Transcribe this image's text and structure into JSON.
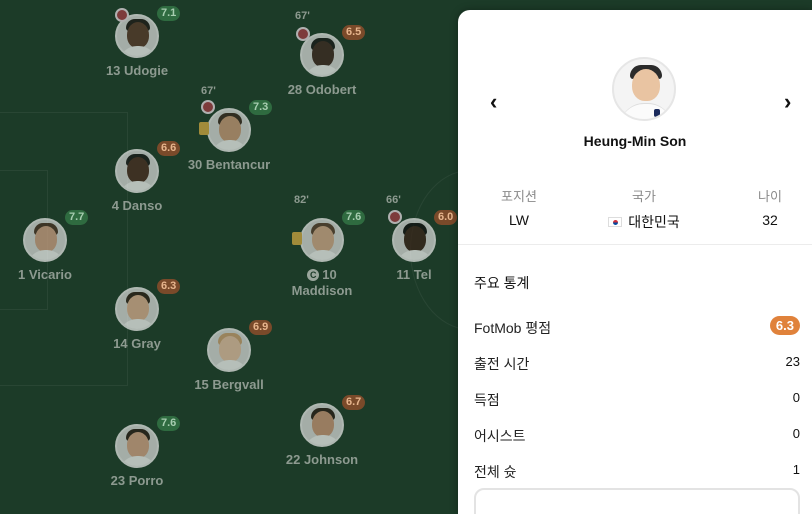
{
  "players": [
    {
      "id": "udogie",
      "name": "13 Udogie",
      "rating": "7.1",
      "color": "green",
      "sub": true,
      "min": ""
    },
    {
      "id": "odobert",
      "name": "28 Odobert",
      "rating": "6.5",
      "color": "orange",
      "sub": true,
      "min": "67'"
    },
    {
      "id": "bentancur",
      "name": "30 Bentancur",
      "rating": "7.3",
      "color": "green",
      "sub": true,
      "min": "67'",
      "card": true
    },
    {
      "id": "danso",
      "name": "4 Danso",
      "rating": "6.6",
      "color": "orange"
    },
    {
      "id": "maddison",
      "name_line1": "10",
      "name_line2": "Maddison",
      "rating": "7.6",
      "color": "green",
      "min": "82'",
      "card": true,
      "captain_icon": "C"
    },
    {
      "id": "tel",
      "name": "11 Tel",
      "rating": "6.0",
      "color": "orange",
      "sub": true,
      "min": "66'"
    },
    {
      "id": "vicario",
      "name": "1 Vicario",
      "rating": "7.7",
      "color": "green"
    },
    {
      "id": "gray",
      "name": "14 Gray",
      "rating": "6.3",
      "color": "orange"
    },
    {
      "id": "bergvall",
      "name": "15 Bergvall",
      "rating": "6.9",
      "color": "orange"
    },
    {
      "id": "johnson",
      "name": "22 Johnson",
      "rating": "6.7",
      "color": "orange"
    },
    {
      "id": "porro",
      "name": "23 Porro",
      "rating": "7.6",
      "color": "green"
    }
  ],
  "panel": {
    "prev_icon": "‹",
    "next_icon": "›",
    "player_name": "Heung-Min Son",
    "info": [
      {
        "label": "포지션",
        "value": "LW"
      },
      {
        "label": "국가",
        "value": "대한민국"
      },
      {
        "label": "나이",
        "value": "32"
      }
    ],
    "section_title": "주요 통계",
    "stats": [
      {
        "label": "FotMob 평점",
        "value": "6.3",
        "badge": true
      },
      {
        "label": "출전 시간",
        "value": "23"
      },
      {
        "label": "득점",
        "value": "0"
      },
      {
        "label": "어시스트",
        "value": "0"
      },
      {
        "label": "전체 슛",
        "value": "1"
      }
    ]
  },
  "colors": {
    "pitch": "#1c3b28",
    "rating_orange": "#e0823b",
    "rating_green": "#2f6b40"
  }
}
